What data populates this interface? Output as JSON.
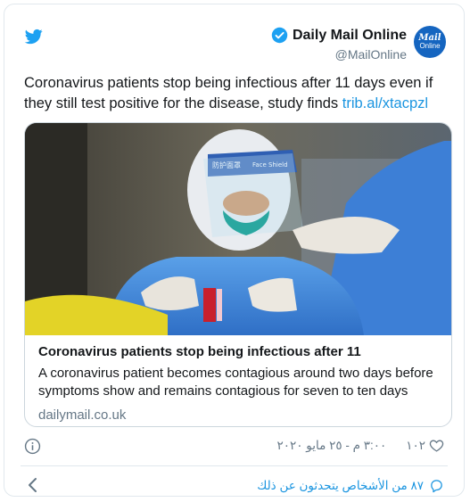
{
  "author": {
    "name": "Daily Mail Online",
    "handle": "@MailOnline",
    "avatar_line1": "Mail",
    "avatar_line2": "Online"
  },
  "tweet": {
    "text": "Coronavirus patients stop being infectious after 11 days even if they still test positive for the disease, study finds ",
    "link": "trib.al/xtacpzl"
  },
  "link_card": {
    "visor_text": "Face Shield",
    "visor_text2": "防护面罩",
    "title": "Coronavirus patients stop being infectious after 11",
    "description": "A coronavirus patient becomes contagious around two days before symptoms show and remains contagious for seven to ten days",
    "domain": "dailymail.co.uk"
  },
  "footer": {
    "like_count": "١٠٢",
    "timestamp": "٣:٠٠ م - ٢٥ مايو ٢٠٢٠",
    "talking": "٨٧ من الأشخاص يتحدثون عن ذلك"
  },
  "colors": {
    "twitter_blue": "#1da1f2",
    "link_blue": "#1b95e0",
    "muted": "#657786"
  }
}
